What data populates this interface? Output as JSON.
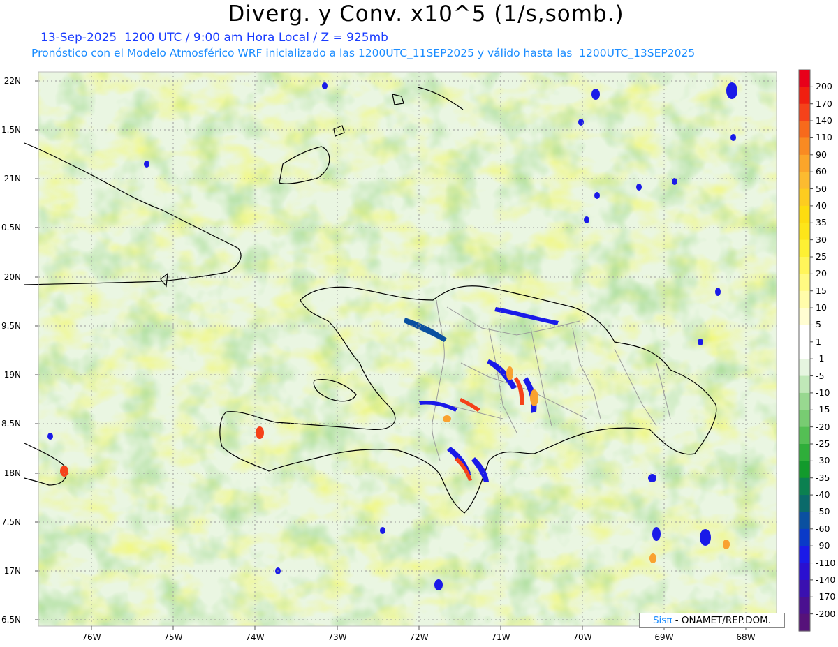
{
  "header": {
    "title": "Diverg. y Conv. x10^5 (1/s,somb.)",
    "line1": "13-Sep-2025  1200 UTC / 9:00 am Hora Local / Z = 925mb",
    "line2": "Pronóstico con el Modelo Atmosférico WRF inicializado a las 1200UTC_11SEP2025 y válido hasta las  1200UTC_13SEP2025"
  },
  "credit": {
    "prefix": "Sis",
    "pi": "π",
    "suffix": " - ONAMET/REP.DOM."
  },
  "axes": {
    "lat_labels": [
      "22N",
      "1.5N",
      "21N",
      "0.5N",
      "20N",
      "9.5N",
      "19N",
      "8.5N",
      "18N",
      "7.5N",
      "17N",
      "6.5N"
    ],
    "lon_labels": [
      "76W",
      "75W",
      "74W",
      "73W",
      "72W",
      "71W",
      "70W",
      "69W",
      "68W"
    ]
  },
  "colorbar": {
    "labels": [
      "200",
      "170",
      "140",
      "110",
      "90",
      "60",
      "50",
      "40",
      "35",
      "30",
      "25",
      "20",
      "15",
      "10",
      "5",
      "1",
      "-1",
      "-5",
      "-10",
      "-15",
      "-20",
      "-25",
      "-30",
      "-35",
      "-40",
      "-50",
      "-60",
      "-90",
      "-110",
      "-140",
      "-170",
      "-200"
    ],
    "colors": [
      "#e8001a",
      "#f01f10",
      "#f5421a",
      "#f76a1c",
      "#f98a22",
      "#fba52a",
      "#fcbb30",
      "#fdcc20",
      "#fddc10",
      "#fde51a",
      "#fef034",
      "#fff55a",
      "#fffa82",
      "#fffcaa",
      "#fffdd2",
      "#ffffff",
      "#ffffff",
      "#e6f5e0",
      "#c0e8b8",
      "#98d890",
      "#78cc72",
      "#54bf54",
      "#2fae3a",
      "#129a2c",
      "#0b8050",
      "#0a6a6a",
      "#0a50a0",
      "#0a3ac8",
      "#1a1ae8",
      "#2a10d0",
      "#3a10b0",
      "#4a1090",
      "#56127a"
    ]
  }
}
